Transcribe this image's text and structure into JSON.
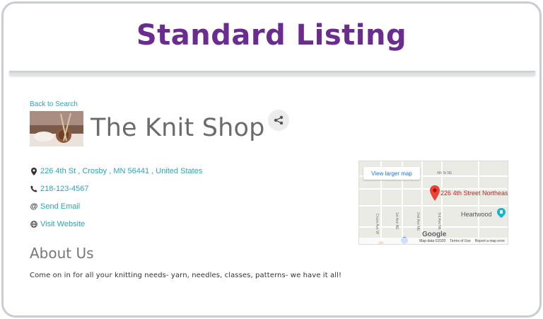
{
  "banner": {
    "title": "Standard Listing"
  },
  "listing": {
    "back_label": "Back to Search",
    "title": "The Knit Shop",
    "address": "226 4th St , Crosby , MN 56441 , United States",
    "phone": "218-123-4567",
    "email_label": "Send Email",
    "website_label": "Visit Website"
  },
  "about": {
    "heading": "About Us",
    "text": "Come on in for all your knitting needs- yarn, needles, classes, patterns- we have it all!"
  },
  "map": {
    "larger_map_label": "View larger map",
    "pin_label": "226 4th Street Northeas",
    "poi_label": "Heartwood",
    "street_4th": "4th St NE",
    "street_1st": "1st Ave NE",
    "street_2nd": "2nd Ave NE",
    "street_3rd": "3rd Ave NE",
    "street_cross": "Cross Ave W",
    "logo": "Google",
    "map_data": "Map data ©2020",
    "terms": "Terms of Use",
    "report": "Report a map error"
  },
  "colors": {
    "brand": "#6a2c8e",
    "link": "#2aa5b8",
    "pin": "#ea4335"
  },
  "icons": {
    "address": "map-marker-icon",
    "phone": "phone-icon",
    "email": "at-icon",
    "website": "globe-icon",
    "share": "share-icon"
  }
}
